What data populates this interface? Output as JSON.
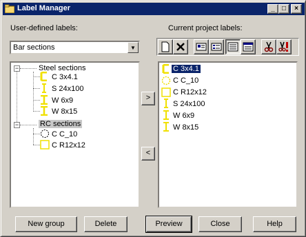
{
  "window": {
    "title": "Label Manager"
  },
  "left": {
    "heading": "User-defined labels:",
    "combo_value": "Bar sections",
    "tree": {
      "group1": "Steel sections",
      "group1_items": [
        "C 3x4.1",
        "S 24x100",
        "W 6x9",
        "W 8x15"
      ],
      "group2": "RC sections",
      "group2_items": [
        "C C_10",
        "C R12x12"
      ]
    }
  },
  "right": {
    "heading": "Current project labels:",
    "items": [
      "C 3x4.1",
      "C C_10",
      "C R12x12",
      "S 24x100",
      "W 6x9",
      "W 8x15"
    ]
  },
  "transfer": {
    "add": ">",
    "remove": "<"
  },
  "buttons": {
    "new_group": "New group",
    "delete": "Delete",
    "preview": "Preview",
    "close": "Close",
    "help": "Help"
  },
  "colors": {
    "titlebar": "#0a246a",
    "selection": "#0a246a",
    "icon_yellow": "#f0e000"
  }
}
